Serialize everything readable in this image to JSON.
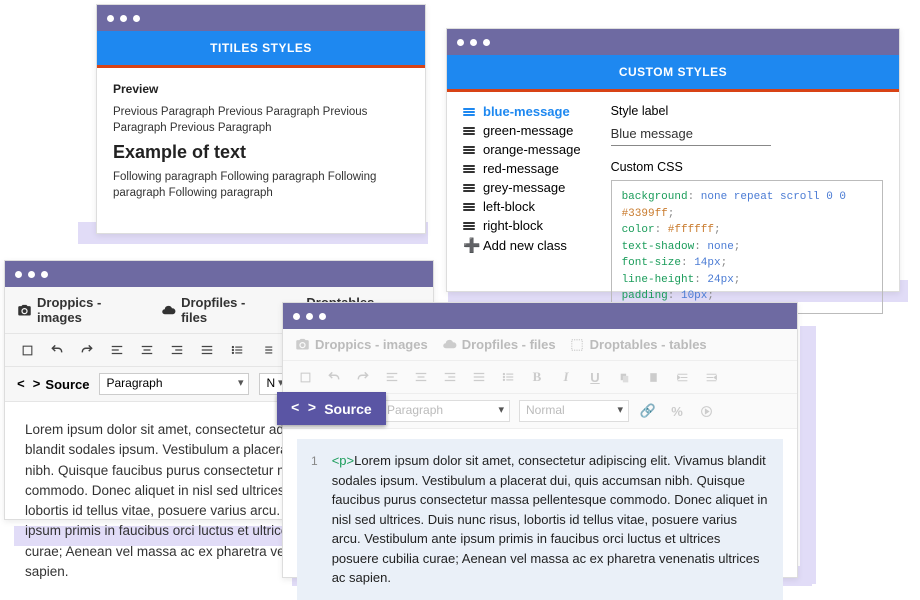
{
  "titles_window": {
    "header": "TITILES STYLES",
    "preview_label": "Preview",
    "prev_para": "Previous Paragraph Previous Paragraph Previous Paragraph Previous Paragraph",
    "example": "Example of text",
    "follow_para": "Following paragraph Following paragraph Following paragraph Following paragraph"
  },
  "custom_window": {
    "header": "CUSTOM STYLES",
    "classes": {
      "c0": "blue-message",
      "c1": "green-message",
      "c2": "orange-message",
      "c3": "red-message",
      "c4": "grey-message",
      "c5": "left-block",
      "c6": "right-block"
    },
    "add_new": "Add new class",
    "style_label_text": "Style label",
    "style_value": "Blue message",
    "custom_css_label": "Custom CSS",
    "css": {
      "l1p": "background",
      "l1v1": "none repeat scroll 0 0",
      "l1v2": "#3399ff",
      "l2p": "color",
      "l2v": "#ffffff",
      "l3p": "text-shadow",
      "l3v": "none",
      "l4p": "font-size",
      "l4v": "14px",
      "l5p": "line-height",
      "l5v": "24px",
      "l6p": "padding",
      "l6v": "10px"
    }
  },
  "editor_window": {
    "plugins": {
      "droppics": "Droppics - images",
      "dropfiles": "Dropfiles - files",
      "droptables": "Droptables - tables"
    },
    "source_label": "Source",
    "para_select": "Paragraph",
    "normal_select_trunc": "N",
    "lorem": "Lorem ipsum dolor sit amet, consectetur adipiscing elit. Vivamus blandit sodales ipsum. Vestibulum a placerat dui, quis accumsan nibh. Quisque faucibus purus consectetur massa pellentesque commodo. Donec aliquet in nisl sed ultrices. Duis nunc risus, lobortis id tellus vitae, posuere varius arcu. Vestibulum ante ipsum primis in faucibus orci luctus et ultrices posuere cubilia curae; Aenean vel massa ac ex pharetra venenatis ultrices ac sapien."
  },
  "source_window": {
    "para_select": "Paragraph",
    "font_select": "Normal",
    "source_label": "Source",
    "line_no": "1",
    "tag_open": "<p>",
    "code_text": "Lorem ipsum dolor sit amet, consectetur adipiscing elit. Vivamus blandit sodales ipsum. Vestibulum a placerat dui, quis accumsan nibh. Quisque faucibus purus consectetur massa pellentesque commodo. Donec aliquet in nisl sed ultrices. Duis nunc risus, lobortis id tellus vitae, posuere varius arcu. Vestibulum ante ipsum primis in faucibus orci luctus et ultrices posuere cubilia curae; Aenean vel massa ac ex pharetra venenatis ultrices ac sapien."
  }
}
